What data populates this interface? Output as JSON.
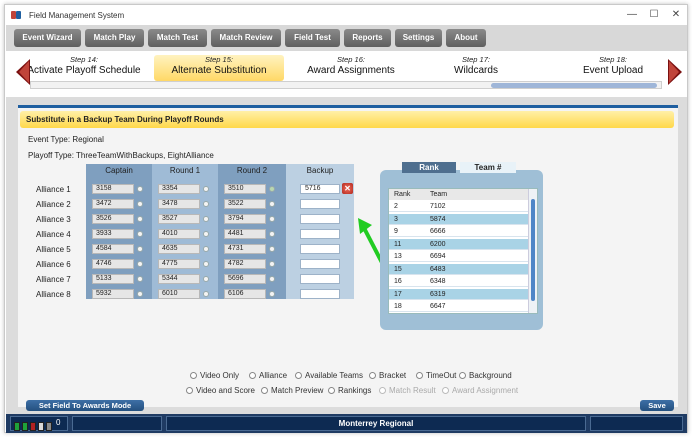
{
  "window": {
    "title": "Field Management System",
    "controls": [
      "—",
      "☐",
      "✕"
    ]
  },
  "colors": {
    "menu_button": "#6f6f6f",
    "active_step": "#ffd866",
    "nav_arrow": "#c0443a",
    "accent_blue": "#1f5fa0",
    "status_bar": "#1f3b63",
    "highlight_arrow": "#22cc22"
  },
  "menu": [
    "Event Wizard",
    "Match Play",
    "Match Test",
    "Match Review",
    "Field Test",
    "Reports",
    "Settings",
    "About"
  ],
  "steps": [
    {
      "num": "Step 14:",
      "name": "Activate Playoff Schedule"
    },
    {
      "num": "Step 15:",
      "name": "Alternate Substitution",
      "active": true
    },
    {
      "num": "Step 16:",
      "name": "Award Assignments"
    },
    {
      "num": "Step 17:",
      "name": "Wildcards"
    },
    {
      "num": "Step 18:",
      "name": "Event Upload"
    }
  ],
  "section_title": "Substitute in a Backup Team During Playoff Rounds",
  "event_type": "Event Type: Regional",
  "playoff_type": "Playoff Type: ThreeTeamWithBackups, EightAlliance",
  "grid": {
    "headers": [
      "Captain",
      "Round 1",
      "Round 2",
      "Backup"
    ],
    "alliances": [
      {
        "label": "Alliance 1",
        "teams": [
          "3158",
          "3354",
          "3510"
        ],
        "backup": "5716"
      },
      {
        "label": "Alliance 2",
        "teams": [
          "3472",
          "3478",
          "3522"
        ],
        "backup": ""
      },
      {
        "label": "Alliance 3",
        "teams": [
          "3526",
          "3527",
          "3794"
        ],
        "backup": ""
      },
      {
        "label": "Alliance 4",
        "teams": [
          "3933",
          "4010",
          "4481"
        ],
        "backup": ""
      },
      {
        "label": "Alliance 5",
        "teams": [
          "4584",
          "4635",
          "4731"
        ],
        "backup": ""
      },
      {
        "label": "Alliance 6",
        "teams": [
          "4746",
          "4775",
          "4782"
        ],
        "backup": ""
      },
      {
        "label": "Alliance 7",
        "teams": [
          "5133",
          "5344",
          "5696"
        ],
        "backup": ""
      },
      {
        "label": "Alliance 8",
        "teams": [
          "5932",
          "6010",
          "6106"
        ],
        "backup": ""
      }
    ]
  },
  "team_list": {
    "tabs": [
      "Rank",
      "Team #"
    ],
    "columns": [
      "Rank",
      "Team"
    ],
    "rows": [
      [
        "2",
        "7102"
      ],
      [
        "3",
        "5874"
      ],
      [
        "9",
        "6666"
      ],
      [
        "11",
        "6200"
      ],
      [
        "13",
        "6694"
      ],
      [
        "15",
        "6483"
      ],
      [
        "16",
        "6348"
      ],
      [
        "17",
        "6319"
      ],
      [
        "18",
        "6647"
      ]
    ]
  },
  "radios_row1": [
    "Video Only",
    "Alliance",
    "Available Teams",
    "Bracket",
    "TimeOut",
    "Background"
  ],
  "radios_row2": [
    "Video and Score",
    "Match Preview",
    "Rankings",
    "Match Result",
    "Award Assignment"
  ],
  "buttons": {
    "awards_mode": "Set Field To Awards Mode",
    "save": "Save"
  },
  "status": {
    "event_name": "Monterrey Regional",
    "counter": "0"
  }
}
